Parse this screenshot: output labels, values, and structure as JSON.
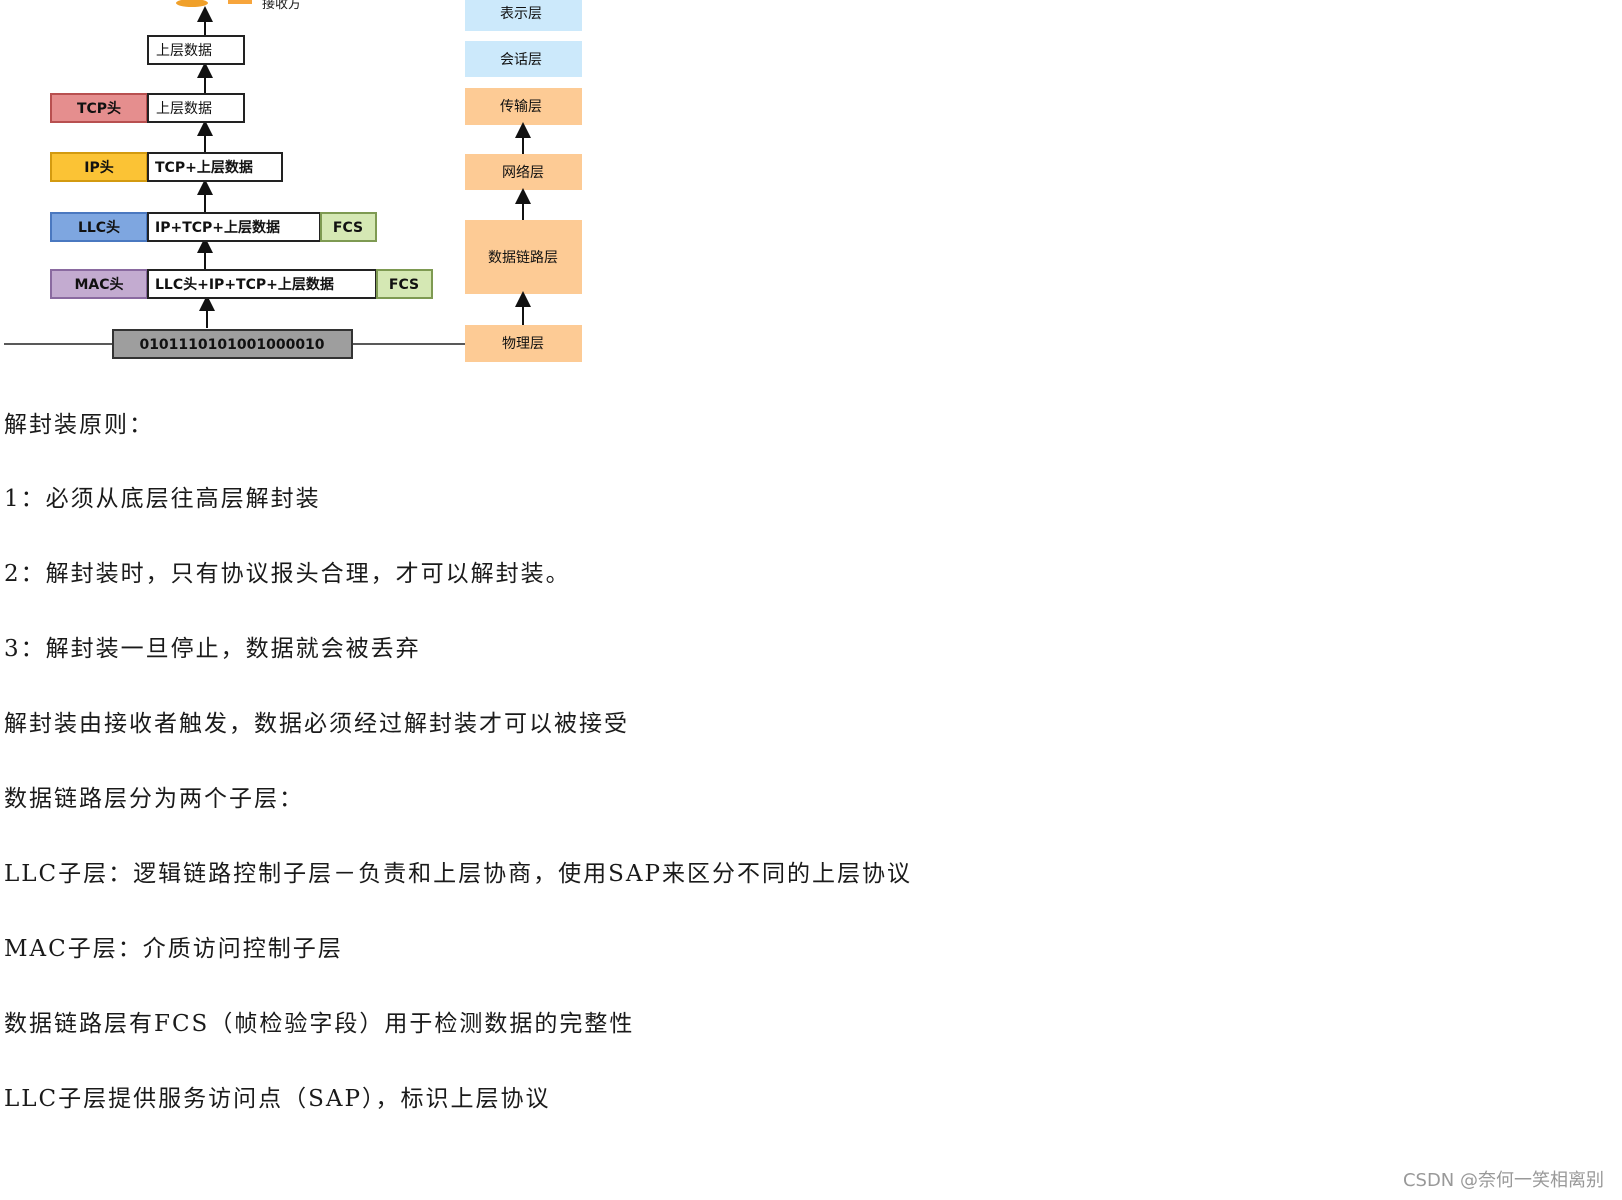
{
  "diagram": {
    "receiver_label": "接收方",
    "boxes": {
      "upper_data_top": "上层数据",
      "tcp_header": "TCP头",
      "upper_data_tcp": "上层数据",
      "ip_header": "IP头",
      "tcp_upper_data": "TCP+上层数据",
      "llc_header": "LLC头",
      "ip_tcp_upper_data": "IP+TCP+上层数据",
      "fcs_llc": "FCS",
      "mac_header": "MAC头",
      "llc_ip_tcp_upper_data": "LLC头+IP+TCP+上层数据",
      "fcs_mac": "FCS",
      "bits": "0101110101001000010"
    },
    "layers": {
      "presentation": "表示层",
      "session": "会话层",
      "transport": "传输层",
      "network": "网络层",
      "data_link": "数据链路层",
      "physical": "物理层"
    },
    "colors": {
      "tcp": "#e58e8e",
      "ip": "#fbc335",
      "llc": "#7ea6e0",
      "mac": "#c3abd0",
      "fcs": "#d5e8b4",
      "bits": "#9e9e9e",
      "layer_upper": "#cce9fb",
      "layer_lower": "#fdcb95"
    }
  },
  "article": {
    "paragraphs": [
      "解封装原则：",
      "1：必须从底层往高层解封装",
      "2：解封装时，只有协议报头合理，才可以解封装。",
      "3：解封装一旦停止，数据就会被丢弃",
      "解封装由接收者触发，数据必须经过解封装才可以被接受",
      "数据链路层分为两个子层：",
      "LLC子层：逻辑链路控制子层－负责和上层协商，使用SAP来区分不同的上层协议",
      "MAC子层：介质访问控制子层",
      "数据链路层有FCS（帧检验字段）用于检测数据的完整性",
      "LLC子层提供服务访问点（SAP），标识上层协议"
    ]
  },
  "watermark": "CSDN @奈何一笑相离别"
}
